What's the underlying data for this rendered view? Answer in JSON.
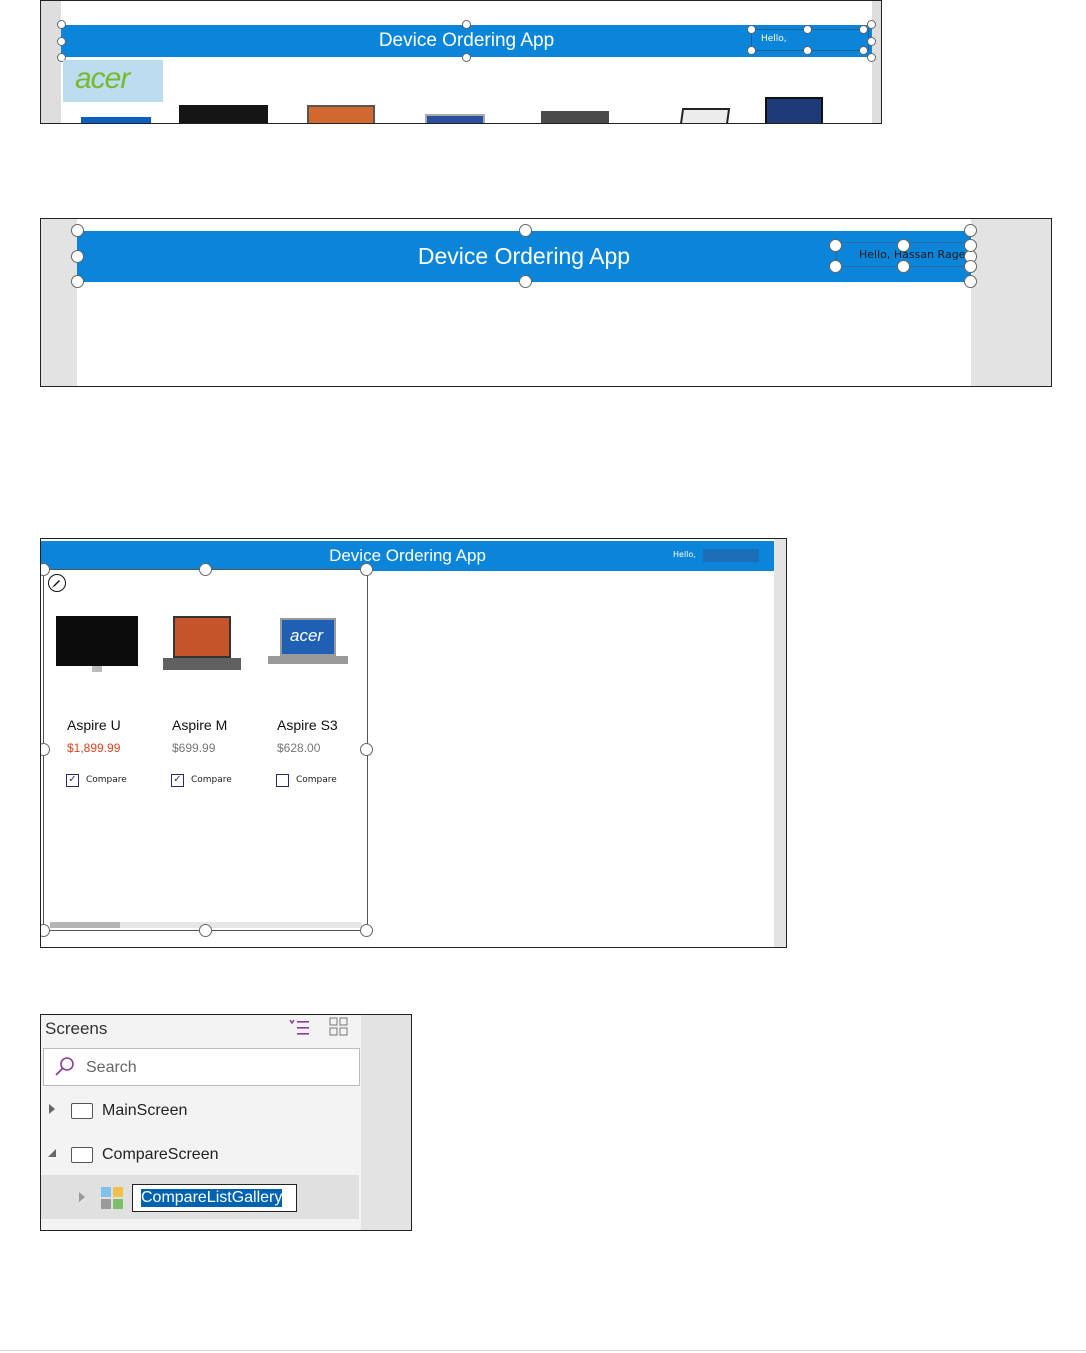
{
  "panel1": {
    "app_title": "Device Ordering App",
    "hello_text": "Hello,",
    "logo_text": "acer"
  },
  "panel2": {
    "app_title": "Device Ordering App",
    "hello_text": "Hello, Hassan Rage"
  },
  "panel3": {
    "app_title": "Device Ordering App",
    "hello_text": "Hello,",
    "products": [
      {
        "name": "Aspire U",
        "price": "$1,899.99",
        "compare_checked": true,
        "price_color": "#d9431e"
      },
      {
        "name": "Aspire M",
        "price": "$699.99",
        "compare_checked": true,
        "price_color": "#777777"
      },
      {
        "name": "Aspire S3",
        "price": "$628.00",
        "compare_checked": false,
        "price_color": "#777777"
      }
    ],
    "compare_label": "Compare",
    "check_glyph": "✓",
    "acer_screen_text": "acer"
  },
  "panel4": {
    "header": "Screens",
    "search_placeholder": "Search",
    "items": [
      {
        "label": "MainScreen"
      },
      {
        "label": "CompareScreen"
      },
      {
        "label": "CompareListGallery"
      }
    ]
  },
  "colors": {
    "accent": "#0a85d9",
    "selection": "#0063b1",
    "purple_icon": "#8b3d9e"
  }
}
